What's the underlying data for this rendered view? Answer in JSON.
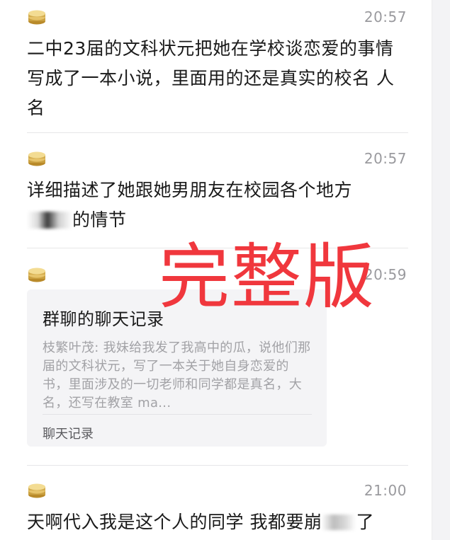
{
  "messages": [
    {
      "time": "20:57",
      "text": "二中23届的文科状元把她在学校谈恋爱的事情写成了一本小说，里面用的还是真实的校名 人名"
    },
    {
      "time": "20:57",
      "text_line1": "详细描述了她跟她男朋友在校园各个地方",
      "text_line2_suffix": "的情节"
    },
    {
      "time": "20:59",
      "card": {
        "title": "群聊的聊天记录",
        "body": "枝繁叶茂: 我妹给我发了我高中的瓜，说他们那届的文科状元，写了一本关于她自身恋爱的书，里面涉及的一切老师和同学都是真名，大名，还写在教室 ma...",
        "footer": "聊天记录"
      }
    },
    {
      "time": "21:00",
      "text_prefix": "天啊代入我是这个人的同学 我都要崩",
      "text_suffix": "了"
    }
  ],
  "watermark": "完整版",
  "colors": {
    "watermark": "#f0373d",
    "time": "#9a9a9e",
    "card_bg": "#f4f4f6"
  },
  "icons": {
    "avatar": "coin-stack-avatar"
  }
}
